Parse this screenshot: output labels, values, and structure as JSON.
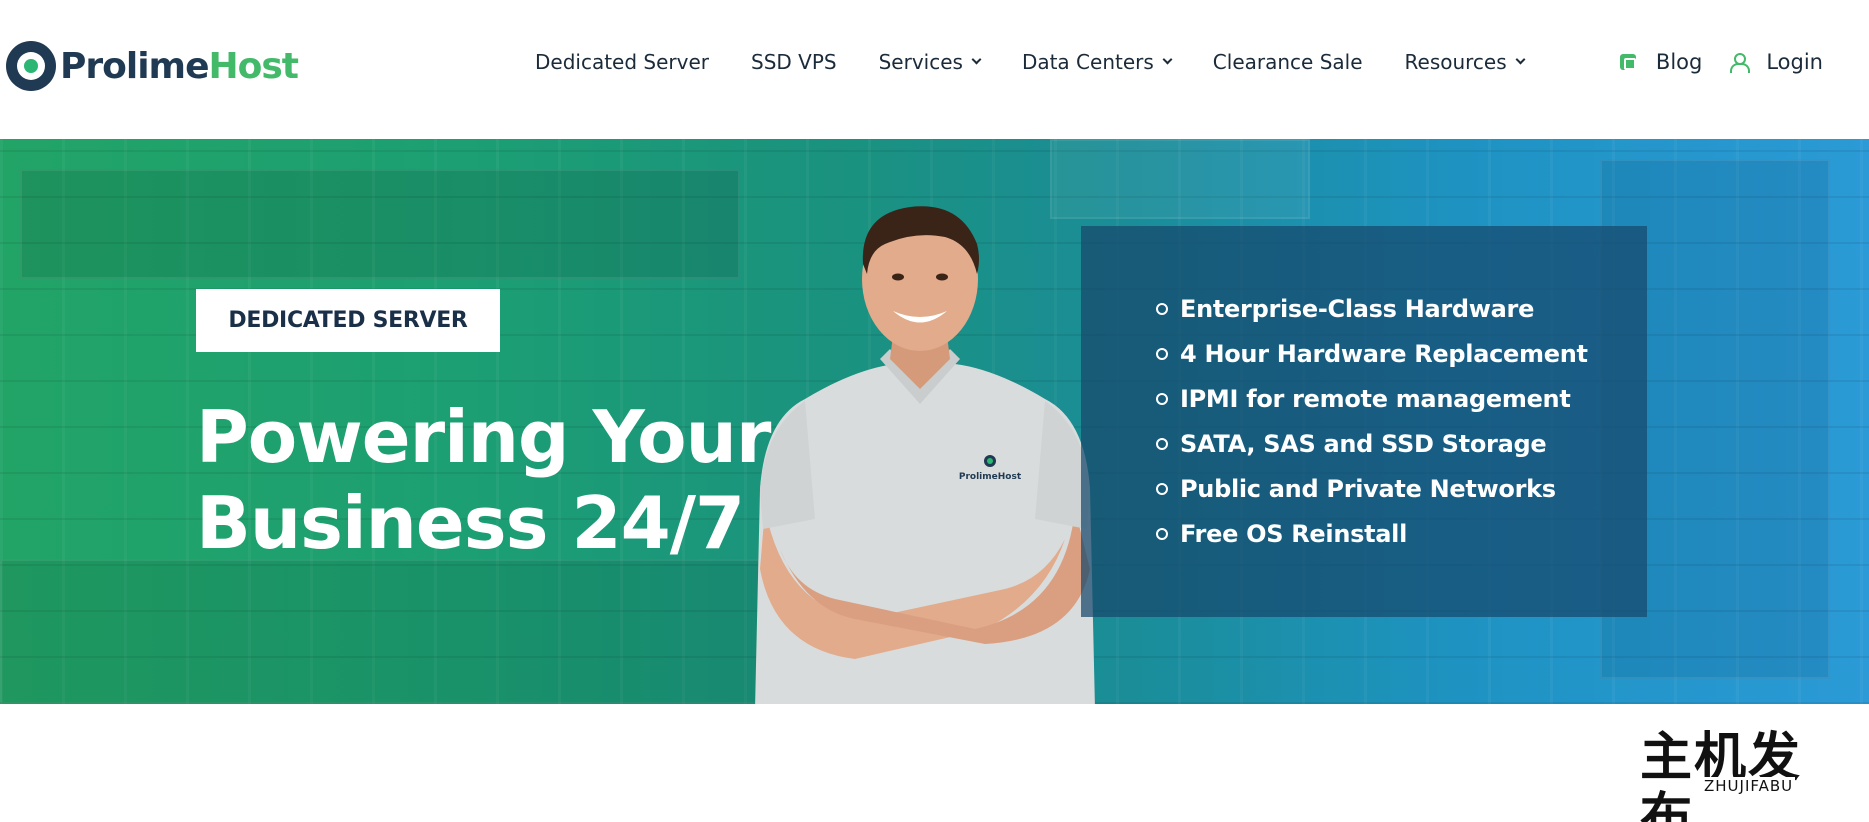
{
  "brand": {
    "name_part1": "Prolime",
    "name_part2": "Host",
    "colors": {
      "navy": "#1f3a52",
      "green": "#43b96a"
    }
  },
  "nav": {
    "items": [
      {
        "label": "Dedicated Server",
        "has_dropdown": false
      },
      {
        "label": "SSD VPS",
        "has_dropdown": false
      },
      {
        "label": "Services",
        "has_dropdown": true
      },
      {
        "label": "Data Centers",
        "has_dropdown": true
      },
      {
        "label": "Clearance Sale",
        "has_dropdown": false
      },
      {
        "label": "Resources",
        "has_dropdown": true
      }
    ]
  },
  "top_links": {
    "blog": {
      "label": "Blog",
      "icon": "blog-icon"
    },
    "login": {
      "label": "Login",
      "icon": "user-icon"
    }
  },
  "hero": {
    "badge": "DEDICATED SERVER",
    "headline_line1": "Powering Your",
    "headline_line2": "Business 24/7",
    "shirt_logo": "ProlimeHost",
    "features": [
      "Enterprise-Class Hardware",
      "4 Hour Hardware Replacement",
      "IPMI for remote management",
      "SATA, SAS and SSD Storage",
      "Public and Private Networks",
      "Free OS Reinstall"
    ],
    "colors": {
      "gradient_start": "#22a467",
      "gradient_end": "#2b9ad6",
      "panel": "#16486c"
    }
  },
  "watermark": {
    "chinese": "主机发布",
    "latin": "ZHUJIFABU"
  }
}
